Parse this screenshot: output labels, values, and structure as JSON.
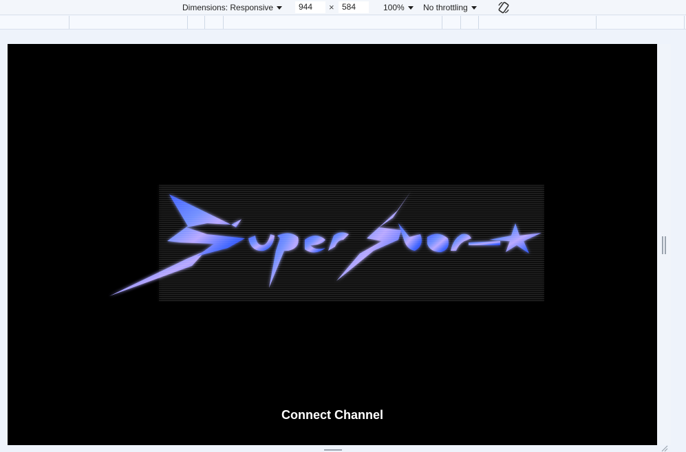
{
  "toolbar": {
    "dimensions_label": "Dimensions: Responsive",
    "width_value": "944",
    "times_symbol": "×",
    "height_value": "584",
    "zoom_label": "100%",
    "throttling_label": "No throttling",
    "rotate_icon": "rotate-icon"
  },
  "viewport": {
    "logo_icon": "superstar-logo",
    "logo_colors": [
      "#3b5bff",
      "#6f8dff",
      "#b7a6ff",
      "#1c2bd8"
    ],
    "connect_label": "Connect Channel"
  }
}
